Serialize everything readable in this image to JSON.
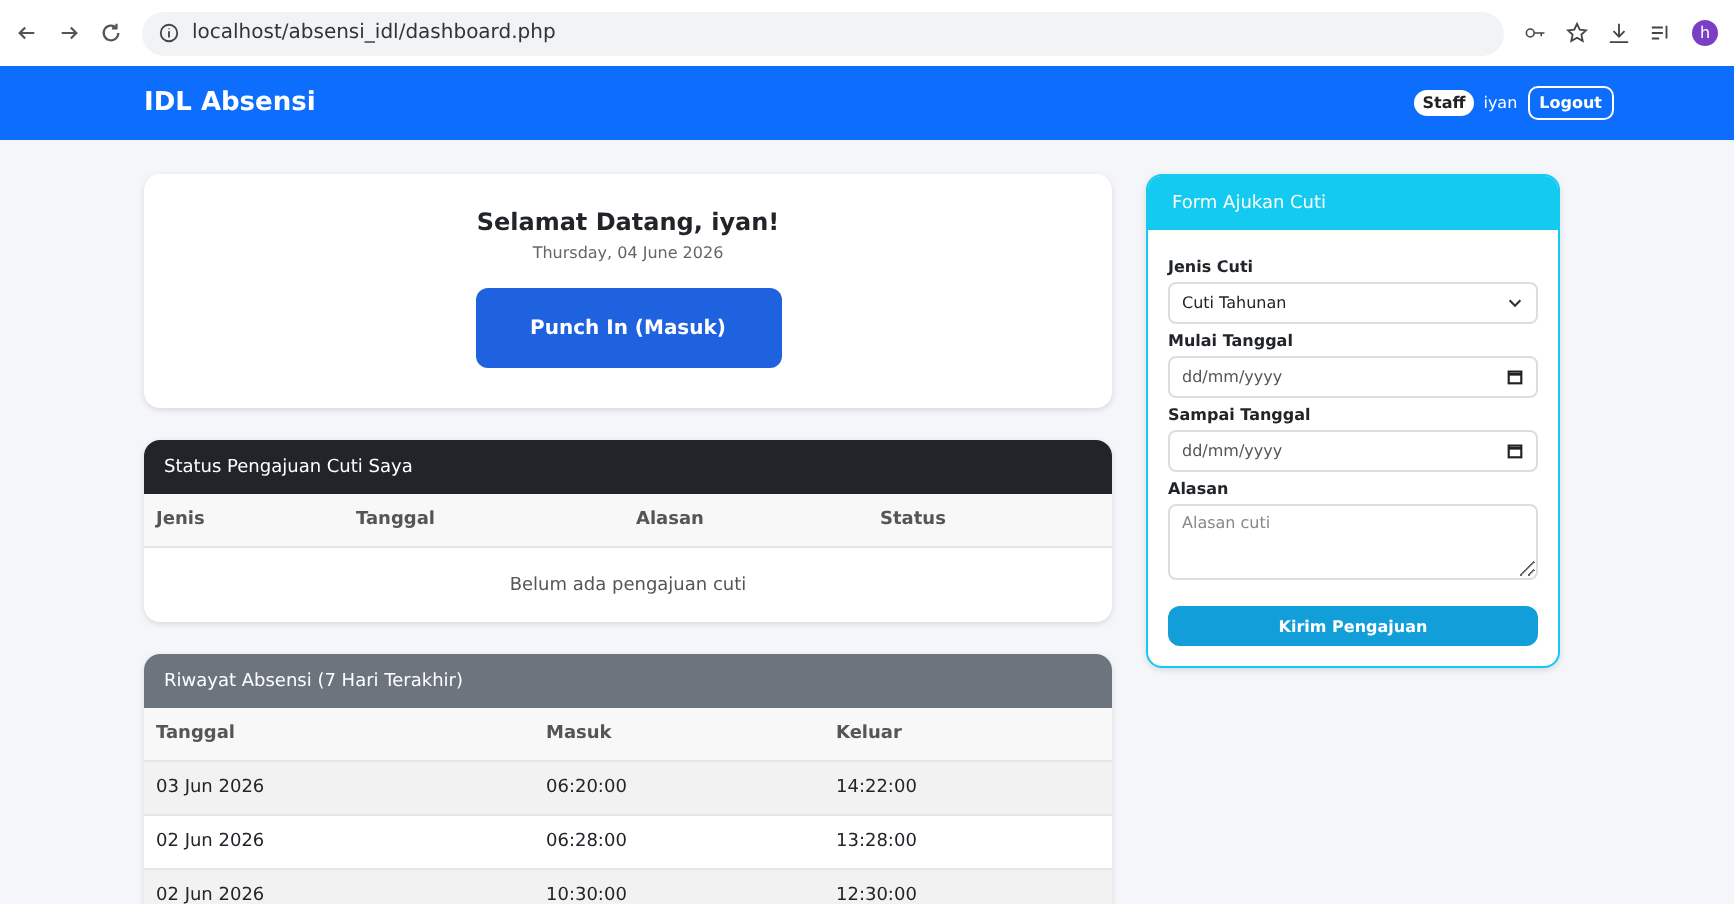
{
  "browser": {
    "url": "localhost/absensi_idl/dashboard.php",
    "profile_initial": "h"
  },
  "navbar": {
    "brand": "IDL Absensi",
    "role_badge": "Staff",
    "user": "iyan",
    "logout": "Logout"
  },
  "welcome": {
    "title": "Selamat Datang, iyan!",
    "date": "Thursday, 04 June 2026",
    "button": "Punch In (Masuk)"
  },
  "leave_status": {
    "title": "Status Pengajuan Cuti Saya",
    "columns": [
      "Jenis",
      "Tanggal",
      "Alasan",
      "Status"
    ],
    "empty": "Belum ada pengajuan cuti"
  },
  "history": {
    "title": "Riwayat Absensi (7 Hari Terakhir)",
    "columns": [
      "Tanggal",
      "Masuk",
      "Keluar"
    ],
    "rows": [
      [
        "03 Jun 2026",
        "06:20:00",
        "14:22:00"
      ],
      [
        "02 Jun 2026",
        "06:28:00",
        "13:28:00"
      ],
      [
        "02 Jun 2026",
        "10:30:00",
        "12:30:00"
      ]
    ]
  },
  "leave_form": {
    "title": "Form Ajukan Cuti",
    "fields": [
      {
        "kind": "select",
        "label": "Jenis Cuti",
        "value": "Cuti Tahunan"
      },
      {
        "kind": "date",
        "label": "Mulai Tanggal",
        "placeholder": "dd/mm/yyyy"
      },
      {
        "kind": "date",
        "label": "Sampai Tanggal",
        "placeholder": "dd/mm/yyyy"
      },
      {
        "kind": "textarea",
        "label": "Alasan",
        "placeholder": "Alasan cuti"
      }
    ],
    "submit": "Kirim Pengajuan"
  }
}
